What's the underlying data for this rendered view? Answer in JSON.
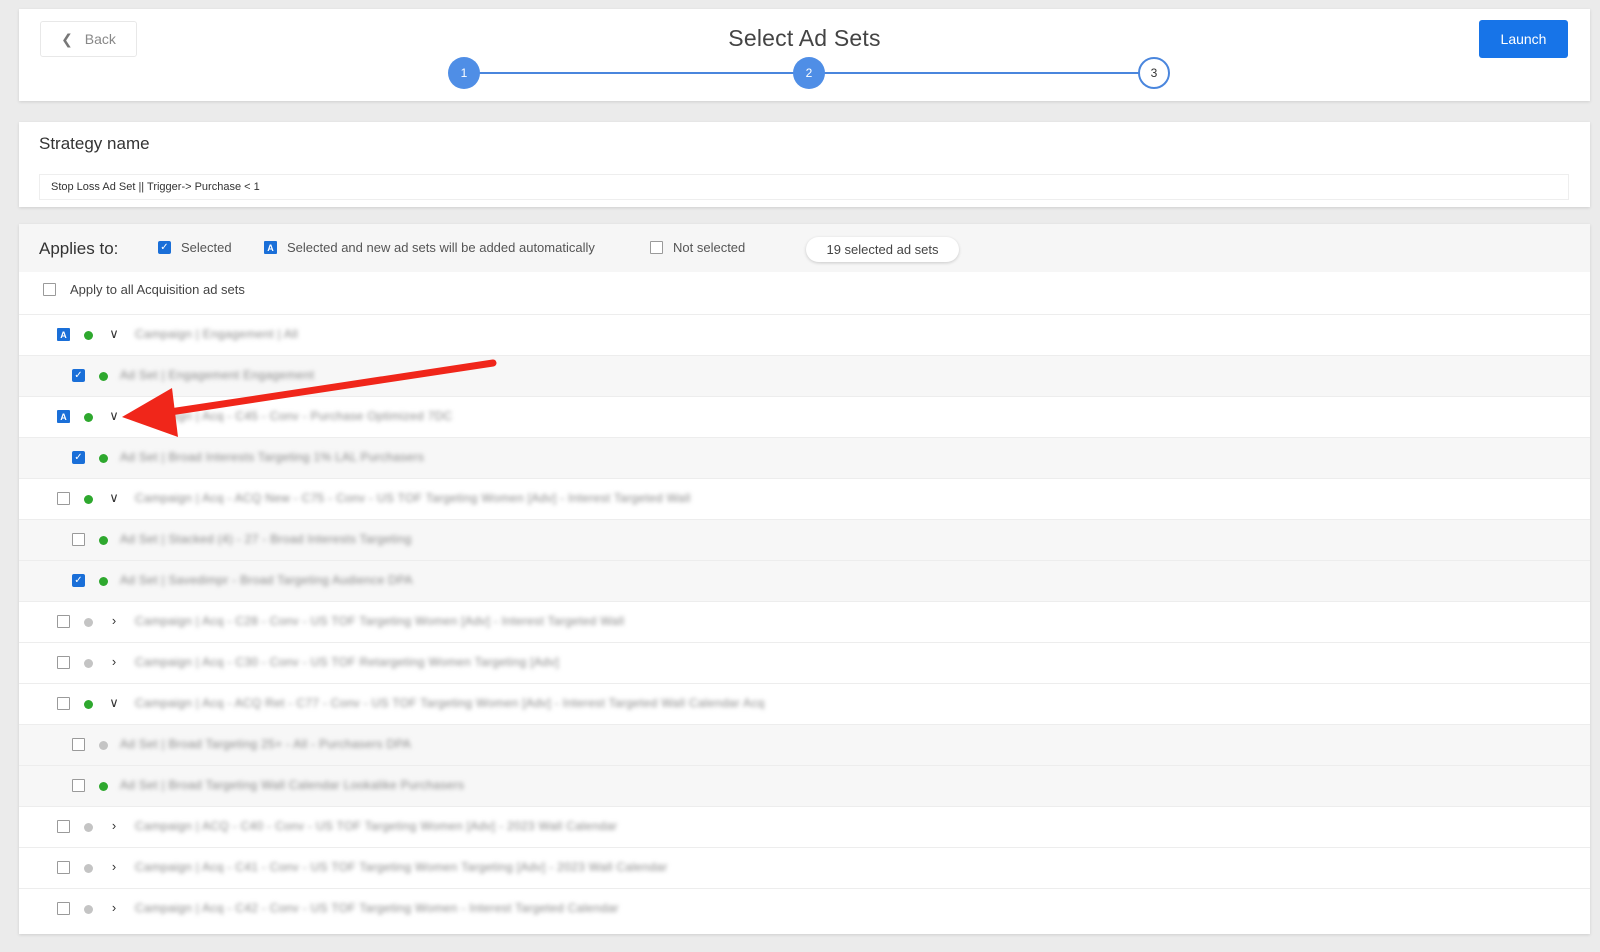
{
  "header": {
    "back_label": "Back",
    "title": "Select Ad Sets",
    "launch_label": "Launch",
    "steps": [
      "1",
      "2",
      "3"
    ]
  },
  "strategy": {
    "label": "Strategy name",
    "value": "Stop Loss Ad Set || Trigger-> Purchase < 1"
  },
  "applies": {
    "label": "Applies to:",
    "legend": {
      "selected": "Selected",
      "auto": "Selected and new ad sets will be added automatically",
      "not_selected": "Not selected"
    },
    "count_pill": "19 selected ad sets",
    "apply_all": "Apply to all Acquisition ad sets",
    "rows": [
      {
        "level": "parent",
        "state": "auto",
        "status": "green",
        "expanded": true,
        "text": "Campaign | Engagement | All"
      },
      {
        "level": "child",
        "state": "checked",
        "status": "green",
        "text": "Ad Set | Engagement Engagement"
      },
      {
        "level": "parent",
        "state": "auto",
        "status": "green",
        "expanded": true,
        "text": "Campaign | Acq - C45 - Conv - Purchase Optimized 7DC"
      },
      {
        "level": "child",
        "state": "checked",
        "status": "green",
        "text": "Ad Set | Broad Interests Targeting 1% LAL Purchasers"
      },
      {
        "level": "parent",
        "state": "empty",
        "status": "green",
        "expanded": true,
        "text": "Campaign | Acq - ACQ New - C75 - Conv - US TOF Targeting Women [Adv] - Interest Targeted Wall"
      },
      {
        "level": "child",
        "state": "empty",
        "status": "green",
        "text": "Ad Set | Stacked (4) - 27 - Broad Interests Targeting"
      },
      {
        "level": "child",
        "state": "checked",
        "status": "green",
        "text": "Ad Set | Savedimpr - Broad Targeting Audience DPA"
      },
      {
        "level": "parent",
        "state": "empty",
        "status": "gray",
        "expanded": false,
        "text": "Campaign | Acq - C28 - Conv - US TOF Targeting Women [Adv] - Interest Targeted Wall"
      },
      {
        "level": "parent",
        "state": "empty",
        "status": "gray",
        "expanded": false,
        "text": "Campaign | Acq - C30 - Conv - US TOF Retargeting Women Targeting [Adv]"
      },
      {
        "level": "parent",
        "state": "empty",
        "status": "green",
        "expanded": true,
        "text": "Campaign | Acq - ACQ Ret - C77 - Conv - US TOF Targeting Women [Adv] - Interest Targeted Wall Calendar Acq"
      },
      {
        "level": "child",
        "state": "empty",
        "status": "gray",
        "text": "Ad Set | Broad Targeting 25+ - All - Purchasers DPA"
      },
      {
        "level": "child",
        "state": "empty",
        "status": "green",
        "text": "Ad Set | Broad Targeting Wall Calendar Lookalike Purchasers"
      },
      {
        "level": "parent",
        "state": "empty",
        "status": "gray",
        "expanded": false,
        "text": "Campaign | ACQ - C40 - Conv - US TOF Targeting Women [Adv] - 2023 Wall Calendar"
      },
      {
        "level": "parent",
        "state": "empty",
        "status": "gray",
        "expanded": false,
        "text": "Campaign | Acq - C41 - Conv - US TOF Targeting Women Targeting [Adv] - 2023 Wall Calendar"
      },
      {
        "level": "parent",
        "state": "empty",
        "status": "gray",
        "expanded": false,
        "text": "Campaign | Acq - C42 - Conv - US TOF Targeting Women - Interest Targeted Calendar"
      }
    ]
  },
  "colors": {
    "primary": "#1774e8",
    "checkbox": "#1a6fd8",
    "active_dot": "#2ea82e",
    "inactive_dot": "#c4c4c4",
    "annotation_arrow": "#f0261a"
  }
}
